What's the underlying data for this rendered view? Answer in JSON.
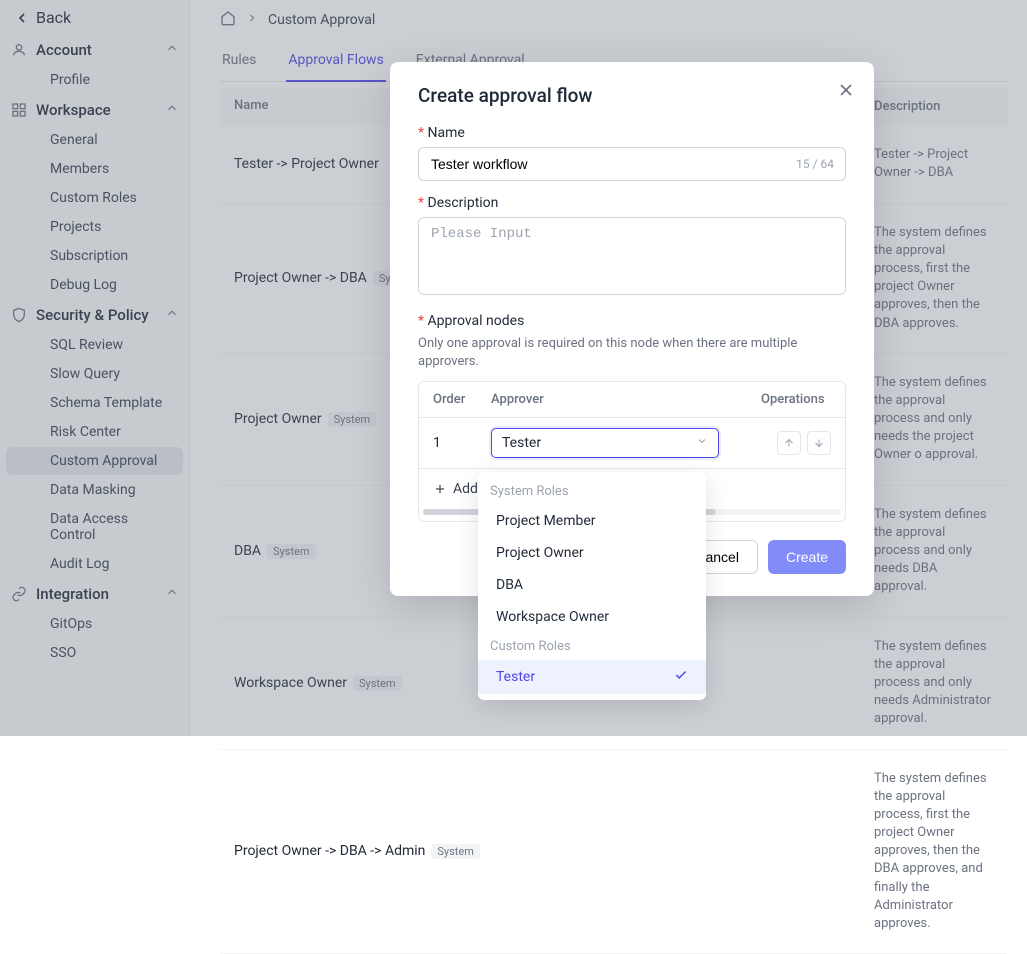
{
  "sidebar": {
    "back": "Back",
    "account": {
      "label": "Account",
      "items": [
        "Profile"
      ]
    },
    "workspace": {
      "label": "Workspace",
      "items": [
        "General",
        "Members",
        "Custom Roles",
        "Projects",
        "Subscription",
        "Debug Log"
      ]
    },
    "security": {
      "label": "Security & Policy",
      "items": [
        "SQL Review",
        "Slow Query",
        "Schema Template",
        "Risk Center",
        "Custom Approval",
        "Data Masking",
        "Data Access Control",
        "Audit Log"
      ]
    },
    "integration": {
      "label": "Integration",
      "items": [
        "GitOps",
        "SSO"
      ]
    }
  },
  "breadcrumb": {
    "home": "⌂",
    "current": "Custom Approval"
  },
  "tabs": {
    "rules": "Rules",
    "flows": "Approval Flows",
    "external": "External Approval"
  },
  "table": {
    "headers": {
      "name": "Name",
      "desc": "Description"
    },
    "rows": [
      {
        "name": "Tester -> Project Owner",
        "system": false,
        "desc": "Tester -> Project Owner -> DBA"
      },
      {
        "name": "Project Owner -> DBA",
        "system": true,
        "desc": "The system defines the approval process, first the project Owner approves, then the DBA approves."
      },
      {
        "name": "Project Owner",
        "system": true,
        "desc": "The system defines the approval process and only needs the project Owner o approval."
      },
      {
        "name": "DBA",
        "system": true,
        "desc": "The system defines the approval process and only needs DBA approval."
      },
      {
        "name": "Workspace Owner",
        "system": true,
        "desc": "The system defines the approval process and only needs Administrator approval."
      },
      {
        "name": "Project Owner -> DBA -> Admin",
        "system": true,
        "desc": "The system defines the approval process, first the project Owner approves, then the DBA approves, and finally the Administrator approves."
      }
    ],
    "system_badge": "System"
  },
  "modal": {
    "title": "Create approval flow",
    "name_label": "Name",
    "name_value": "Tester workflow",
    "char_count": "15 / 64",
    "desc_label": "Description",
    "desc_placeholder": "Please Input",
    "nodes_label": "Approval nodes",
    "nodes_hint": "Only one approval is required on this node when there are multiple approvers.",
    "cols": {
      "order": "Order",
      "approver": "Approver",
      "ops": "Operations"
    },
    "row": {
      "order": "1",
      "approver": "Tester"
    },
    "add_node": "Add node",
    "cancel": "Cancel",
    "create": "Create"
  },
  "dropdown": {
    "group1": "System Roles",
    "items1": [
      "Project Member",
      "Project Owner",
      "DBA",
      "Workspace Owner"
    ],
    "group2": "Custom Roles",
    "items2": [
      "Tester"
    ]
  }
}
